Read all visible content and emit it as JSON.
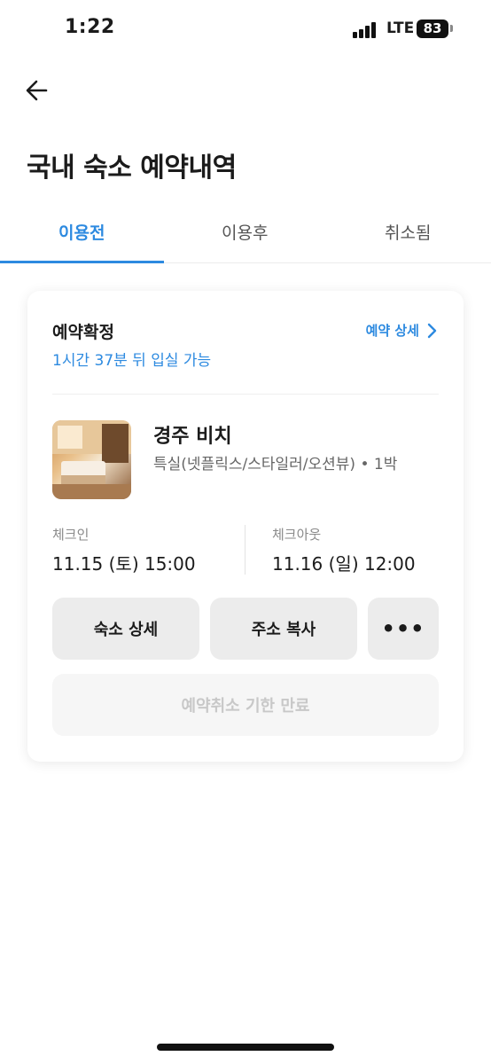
{
  "status_bar": {
    "time": "1:22",
    "network": "LTE",
    "battery": "83"
  },
  "header": {
    "title": "국내 숙소 예약내역"
  },
  "tabs": [
    {
      "label": "이용전",
      "active": true
    },
    {
      "label": "이용후",
      "active": false
    },
    {
      "label": "취소됨",
      "active": false
    }
  ],
  "booking": {
    "status": "예약확정",
    "countdown": "1시간 37분 뒤 입실 가능",
    "detail_link": "예약 상세",
    "hotel_name": "경주 비치",
    "room_type": "특실(넷플릭스/스타일러/오션뷰)",
    "nights": "1박",
    "checkin_label": "체크인",
    "checkin_value": "11.15 (토) 15:00",
    "checkout_label": "체크아웃",
    "checkout_value": "11.16 (일) 12:00",
    "buttons": {
      "hotel_detail": "숙소 상세",
      "copy_address": "주소 복사",
      "more": "•••"
    },
    "cancel_label": "예약취소 기한 만료"
  },
  "colors": {
    "accent": "#2d8ae0",
    "button_bg": "#ececec",
    "disabled_text": "#c8c8c8"
  }
}
